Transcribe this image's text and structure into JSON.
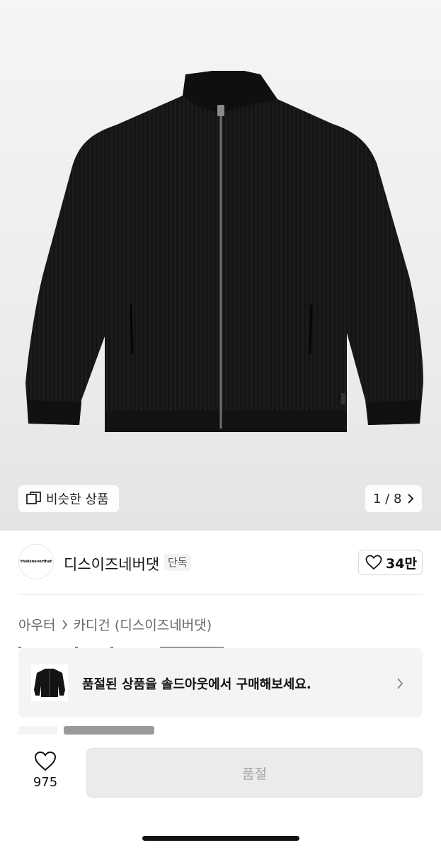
{
  "gallery": {
    "similar_label": "비슷한 상품",
    "counter": "1 / 8"
  },
  "brand": {
    "logo_text": "thisisneverthat",
    "name": "디스이즈네버댓",
    "badge": "단독",
    "likes": "34만"
  },
  "breadcrumb": {
    "category": "아우터",
    "subcategory": "카디건 (디스이즈네버댓)"
  },
  "soldout_banner": {
    "message": "품절된 상품을 솔드아웃에서 구매해보세요."
  },
  "bottom": {
    "wish_count": "975",
    "buy_label": "품절"
  },
  "icons": [
    "similar-products-icon",
    "chevron-right-icon",
    "heart-icon",
    "product-thumbnail"
  ]
}
